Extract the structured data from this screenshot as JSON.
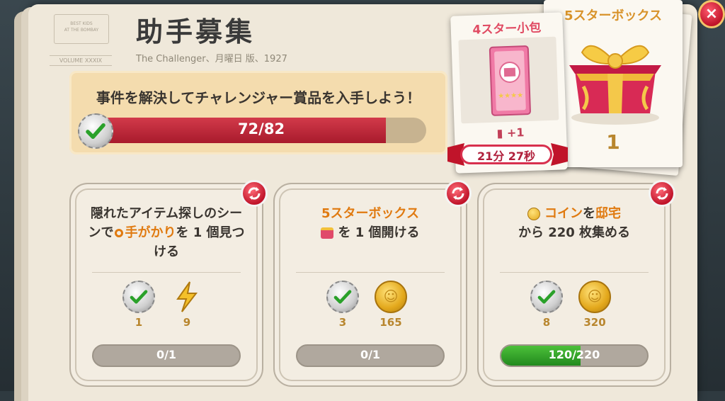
{
  "header": {
    "title": "助手募集",
    "subtitle": "The Challenger、月曜日 版、1927",
    "stamp_top": "BEST KIDS\nAT THE BOMBAY",
    "stamp_bottom": "VOLUME XXXIX"
  },
  "banner": {
    "text": "事件を解決してチャレンジャー賞品を入手しよう！",
    "progress_label": "72/82",
    "progress_fraction": 0.878
  },
  "reward_cards": {
    "four_star": {
      "title": "4スター小包",
      "plus": "+1",
      "timer": "21分 27秒"
    },
    "five_star": {
      "title": "5スターボックス",
      "count": "1"
    }
  },
  "tasks": [
    {
      "text_part1": "隠れたアイテム探しのシーンで",
      "text_highlight": "手がかり",
      "text_part2": "を 1 個見つける",
      "rewards": [
        {
          "icon": "check-badge-icon",
          "value": "1"
        },
        {
          "icon": "lightning-icon",
          "value": "9"
        }
      ],
      "progress_label": "0/1",
      "progress_fraction": 0
    },
    {
      "text_highlight": "5スターボックス",
      "text_part2": "を 1 個開ける",
      "rewards": [
        {
          "icon": "check-badge-icon",
          "value": "3"
        },
        {
          "icon": "coin-icon",
          "value": "165"
        }
      ],
      "progress_label": "0/1",
      "progress_fraction": 0
    },
    {
      "text_highlight1": "コイン",
      "text_mid": "を",
      "text_highlight2": "邸宅",
      "text_part2": "から 220 枚集める",
      "rewards": [
        {
          "icon": "check-badge-icon",
          "value": "8"
        },
        {
          "icon": "coin-icon",
          "value": "320"
        }
      ],
      "progress_label": "120/220",
      "progress_fraction": 0.5455
    }
  ],
  "close_label": "×"
}
